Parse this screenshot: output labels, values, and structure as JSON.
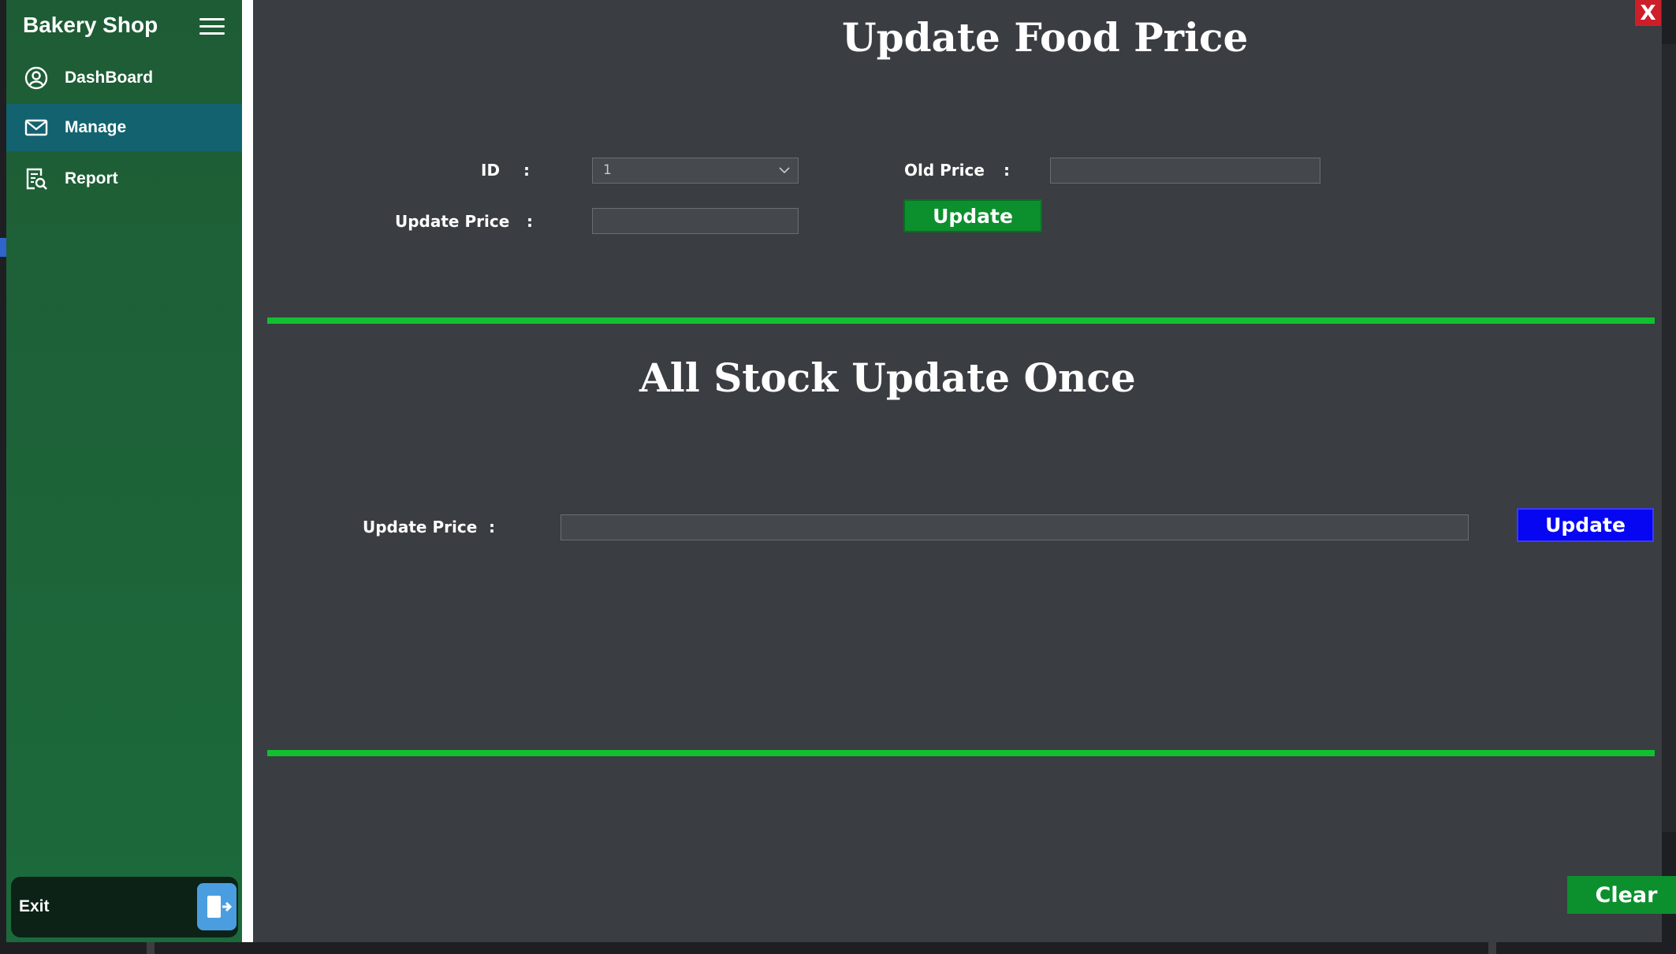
{
  "app": {
    "brand": "Bakery Shop",
    "close_label": "X"
  },
  "sidebar": {
    "items": [
      {
        "label": "DashBoard",
        "icon": "user-circle-icon"
      },
      {
        "label": "Manage",
        "icon": "mail-icon",
        "active": true
      },
      {
        "label": "Report",
        "icon": "report-search-icon"
      }
    ],
    "exit_label": "Exit"
  },
  "update_food_price": {
    "title": "Update Food Price",
    "id_label": "ID",
    "id_value": "1",
    "old_price_label": "Old Price",
    "old_price_value": "",
    "update_price_label": "Update Price",
    "update_price_value": "",
    "colon": ":",
    "update_button": "Update"
  },
  "all_stock_update": {
    "title": "All Stock Update Once",
    "update_price_label": "Update Price",
    "update_price_value": "",
    "colon": ":",
    "update_button": "Update"
  },
  "footer": {
    "clear_button": "Clear"
  },
  "colors": {
    "sidebar": "#1e5c35",
    "active_nav": "#12636f",
    "panel": "#3a3d41",
    "accent_green": "#11c030",
    "update_green": "#0c8f2d",
    "update_blue": "#0606f2",
    "close_red": "#cc1f2a"
  }
}
